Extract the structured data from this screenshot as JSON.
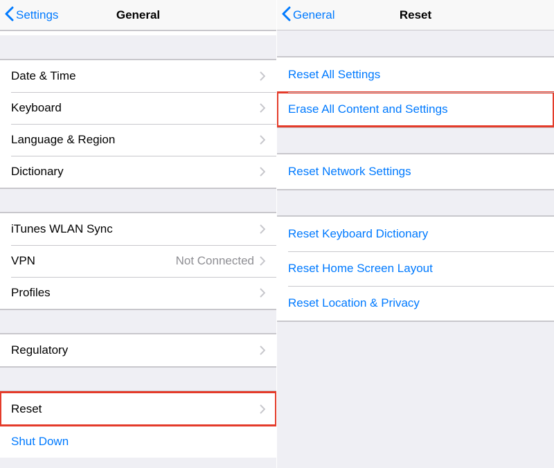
{
  "left": {
    "back_label": "Settings",
    "title": "General",
    "rows": {
      "date_time": "Date & Time",
      "keyboard": "Keyboard",
      "language_region": "Language & Region",
      "dictionary": "Dictionary",
      "itunes_wlan": "iTunes WLAN Sync",
      "vpn": "VPN",
      "vpn_value": "Not Connected",
      "profiles": "Profiles",
      "regulatory": "Regulatory",
      "reset": "Reset",
      "shutdown": "Shut Down"
    }
  },
  "right": {
    "back_label": "General",
    "title": "Reset",
    "rows": {
      "reset_all": "Reset All Settings",
      "erase_all": "Erase All Content and Settings",
      "reset_network": "Reset Network Settings",
      "reset_keyboard": "Reset Keyboard Dictionary",
      "reset_home": "Reset Home Screen Layout",
      "reset_location": "Reset Location & Privacy"
    }
  }
}
